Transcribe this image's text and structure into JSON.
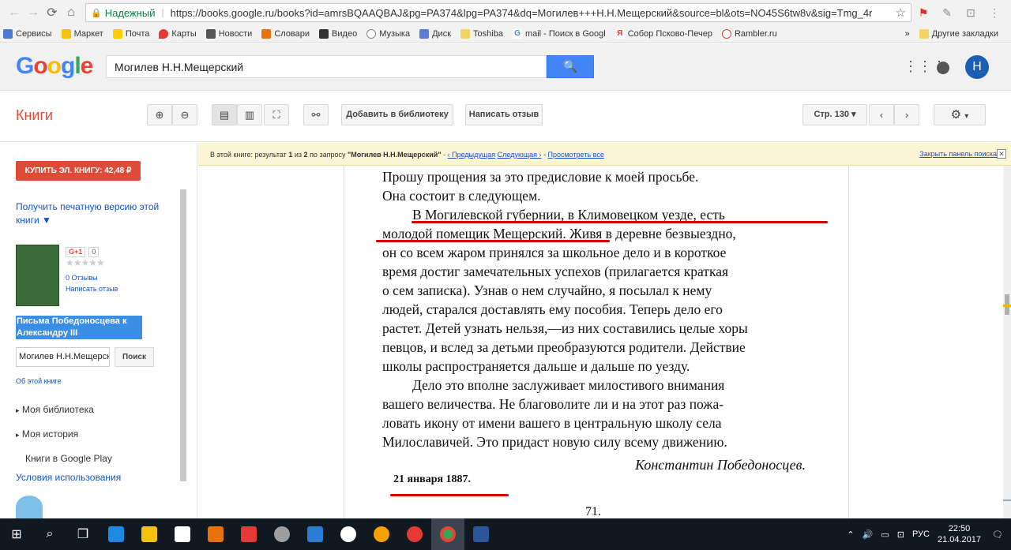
{
  "browser": {
    "secure_label": "Надежный",
    "url": "https://books.google.ru/books?id=amrsBQAAQBAJ&pg=PA374&lpg=PA374&dq=Могилев+++Н.Н.Мещерский&source=bl&ots=NO45S6tw8v&sig=Tmg_4r",
    "bookmarks": [
      "Сервисы",
      "Маркет",
      "Почта",
      "Карты",
      "Новости",
      "Словари",
      "Видео",
      "Музыка",
      "Диск",
      "Toshiba",
      "mail - Поиск в Googl",
      "Собор Псково-Печер",
      "Rambler.ru"
    ],
    "more": "»",
    "other_bookmarks": "Другие закладки"
  },
  "google": {
    "logo": [
      "G",
      "o",
      "o",
      "g",
      "l",
      "e"
    ],
    "query": "Могилев   Н.Н.Мещерский",
    "avatar_letter": "Н"
  },
  "toolbar": {
    "section": "Книги",
    "add_library": "Добавить в библиотеку",
    "write_review": "Написать отзыв",
    "page_select": "Стр. 130"
  },
  "result_bar": {
    "prefix": "В этой книге: результат",
    "current": "1",
    "of": "из",
    "total": "2",
    "by_query": "по запросу",
    "query": "\"Могилев Н.Н.Мещерский\"",
    "dash": " - ",
    "prev": "‹ Предыдущая",
    "next": "Следующая ›",
    "sep": " - ",
    "view_all": "Просмотреть все",
    "close": "Закрыть панель поиска"
  },
  "left": {
    "buy": "КУПИТЬ ЭЛ. КНИГУ: 42,48 ₽",
    "print": "Получить печатную версию этой книги ▼",
    "gplus": "G+1",
    "gplus_count": "0",
    "reviews": "0 Отзывы",
    "write_review": "Написать отзыв",
    "book_title": "Письма Победоносцева к Александру III",
    "search_value": "Могилев   Н.Н.Мещерский",
    "search_btn": "Поиск",
    "about": "Об этой книге",
    "my_library": "Моя библиотека",
    "my_history": "Моя история",
    "play": "Книги в Google Play",
    "terms": "Условия использования"
  },
  "page": {
    "lines": [
      "Прошу прощения за это предисловие к моей просьбе.",
      "Она состоит в следующем.",
      "В Могилевской губернии, в Климовецком уезде, есть",
      "молодой помещик Мещерский. Живя в деревне безвыездно,",
      "он со всем жаром принялся за школьное дело и в короткое",
      "время достиг замечательных успехов (прилагается краткая",
      "о сем записка). Узнав о нем случайно, я посылал к нему",
      "людей, старался доставлять ему пособия. Теперь дело его",
      "растет. Детей узнать нельзя,—из них составились целые хоры",
      "певцов, и вслед за детьми преобразуются родители. Действие",
      "школы распространяется дальше и дальше по уезду.",
      "Дело это вполне заслуживает милостивого внимания",
      "вашего величества. Не благоволите ли и на этот раз пожа-",
      "ловать икону от имени вашего в центральную школу села",
      "Милославичей. Это придаст новую силу всему движению."
    ],
    "signature": "Константин Победоносцев.",
    "date": "21 января 1887.",
    "page_number": "71."
  },
  "taskbar": {
    "lang": "РУС",
    "time": "22:50",
    "date": "21.04.2017"
  }
}
